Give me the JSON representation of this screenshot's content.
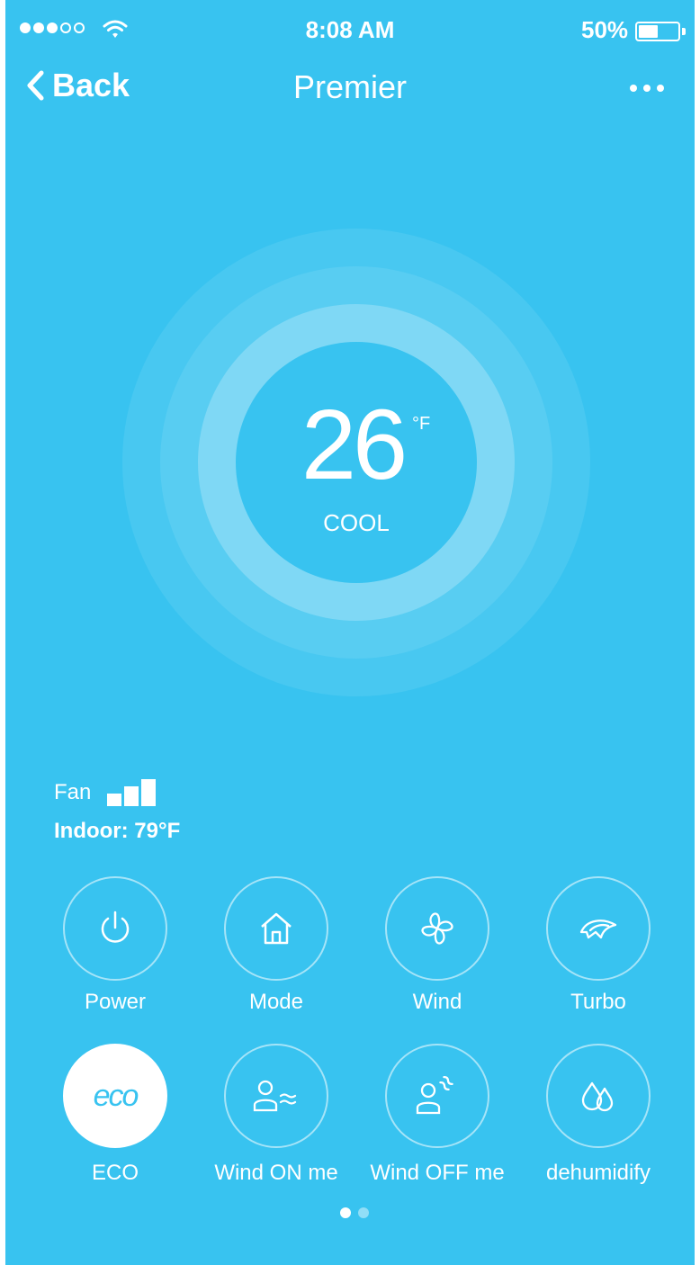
{
  "status_bar": {
    "time": "8:08 AM",
    "battery_percent": "50%",
    "battery_level": 0.5,
    "signal_filled": 3,
    "signal_total": 5
  },
  "nav": {
    "back_label": "Back",
    "title": "Premier",
    "more_icon": "more-horizontal-icon"
  },
  "thermostat": {
    "temperature": "26",
    "unit": "°F",
    "mode": "COOL"
  },
  "info": {
    "fan_label": "Fan",
    "fan_level": 3,
    "fan_level_max": 3,
    "indoor": "Indoor: 79°F"
  },
  "controls": [
    {
      "label": "Power",
      "icon": "power-icon",
      "active": false
    },
    {
      "label": "Mode",
      "icon": "home-icon",
      "active": false
    },
    {
      "label": "Wind",
      "icon": "fan-icon",
      "active": false
    },
    {
      "label": "Turbo",
      "icon": "turbo-icon",
      "active": false
    },
    {
      "label": "ECO",
      "icon": "eco-icon",
      "icon_text": "eco",
      "active": true
    },
    {
      "label": "Wind ON me",
      "icon": "wind-on-me-icon",
      "active": false
    },
    {
      "label": "Wind OFF me",
      "icon": "wind-off-me-icon",
      "active": false
    },
    {
      "label": "dehumidify",
      "icon": "water-drops-icon",
      "active": false
    }
  ],
  "pager": {
    "current": 1,
    "total": 2
  },
  "colors": {
    "background": "#38C3F0",
    "foreground": "#FFFFFF"
  }
}
